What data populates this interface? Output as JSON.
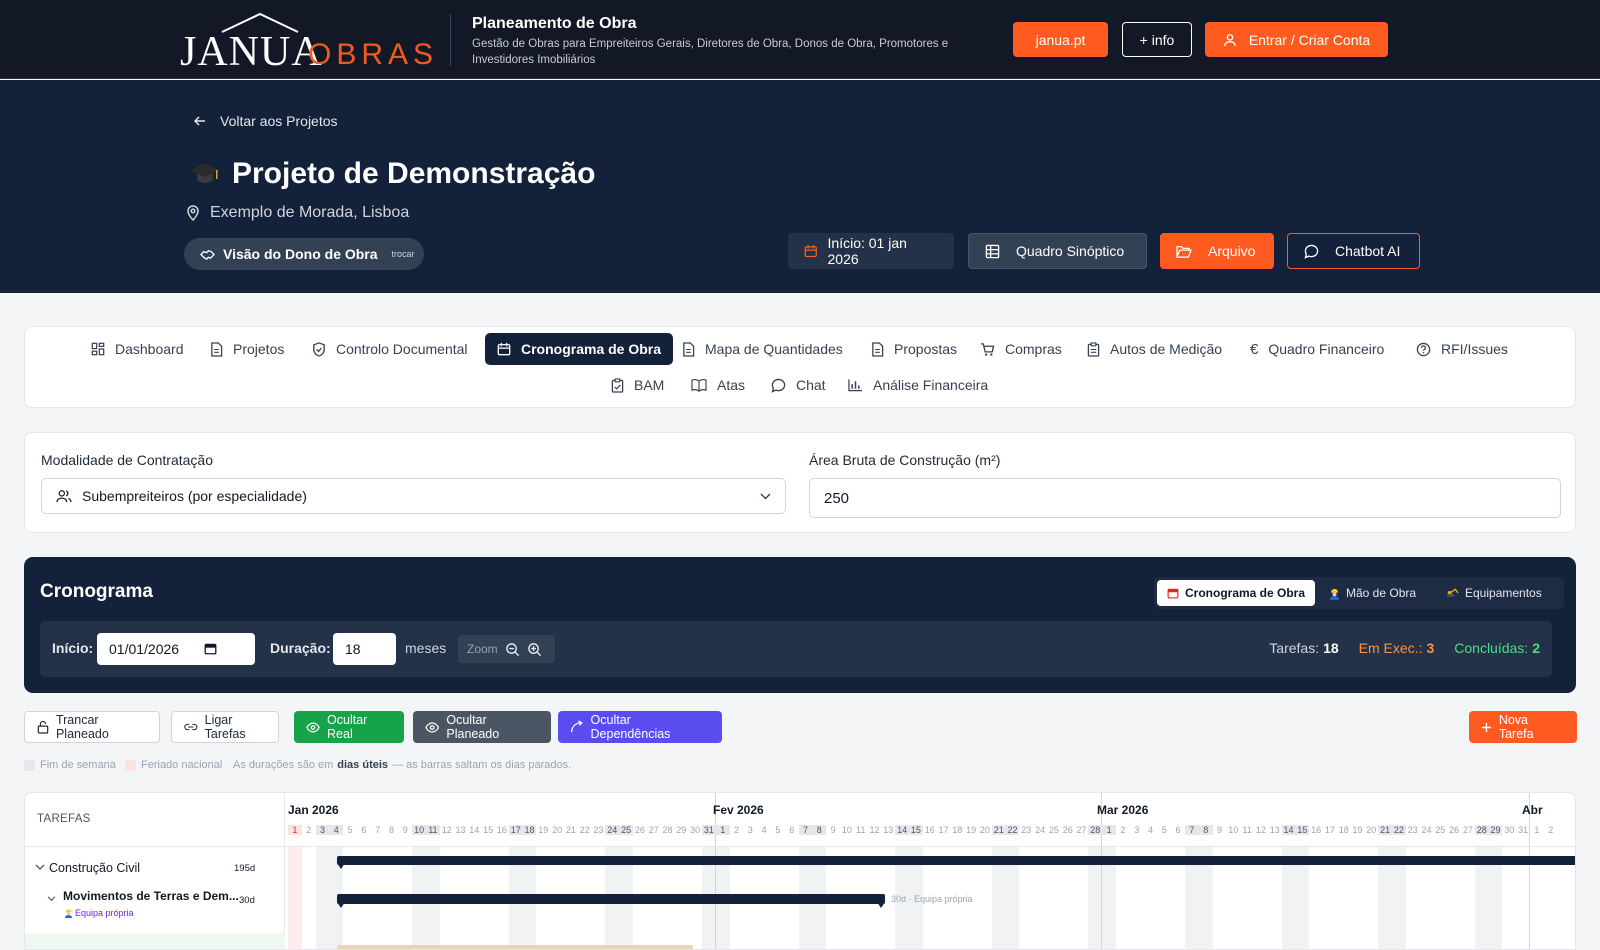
{
  "header": {
    "logo_main": "JANUA",
    "logo_sub": "OBRAS",
    "title": "Planeamento de Obra",
    "subtitle": "Gestão de Obras para Empreiteiros Gerais, Diretores de Obra, Donos de Obra, Promotores e Investidores Imobiliários",
    "btn_site": "janua.pt",
    "btn_info": "+ info",
    "btn_login": "Entrar / Criar Conta"
  },
  "hero": {
    "back_label": "Voltar aos Projetos",
    "project_title": "Projeto de Demonstração",
    "address": "Exemplo de Morada, Lisboa",
    "view_label": "Visão do Dono de Obra",
    "view_switch": "trocar",
    "start_label": "Início: 01 jan 2026",
    "btn_quadro": "Quadro Sinóptico",
    "btn_arquivo": "Arquivo",
    "btn_chatbot": "Chatbot AI"
  },
  "tabs": {
    "row1": [
      "Dashboard",
      "Projetos",
      "Controlo Documental",
      "Cronograma de Obra",
      "Mapa de Quantidades",
      "Propostas",
      "Compras",
      "Autos de Medição",
      "Quadro Financeiro",
      "RFI/Issues"
    ],
    "row2": [
      "BAM",
      "Atas",
      "Chat",
      "Análise Financeira"
    ],
    "active": "Cronograma de Obra"
  },
  "form": {
    "modalidade_label": "Modalidade de Contratação",
    "modalidade_value": "Subempreiteiros (por especialidade)",
    "area_label": "Área Bruta de Construção (m²)",
    "area_value": "250"
  },
  "cronograma": {
    "title": "Cronograma",
    "views": [
      "Cronograma de Obra",
      "Mão de Obra",
      "Equipamentos"
    ],
    "inicio_label": "Início:",
    "inicio_value": "01/01/2026",
    "duracao_label": "Duração:",
    "duracao_value": "18",
    "duracao_unit": "meses",
    "zoom_label": "Zoom",
    "stats": {
      "tarefas_label": "Tarefas:",
      "tarefas_value": "18",
      "exec_label": "Em Exec.:",
      "exec_value": "3",
      "concl_label": "Concluídas:",
      "concl_value": "2"
    }
  },
  "actions": {
    "trancar": "Trancar Planeado",
    "ligar": "Ligar Tarefas",
    "ocultar_real": "Ocultar Real",
    "ocultar_planeado": "Ocultar Planeado",
    "ocultar_dep": "Ocultar Dependências",
    "nova": "Nova Tarefa"
  },
  "legend": {
    "fim_semana": "Fim de semana",
    "feriado": "Feriado nacional",
    "note_pre": "As durações são em",
    "note_bold": "dias úteis",
    "note_post": "— as barras saltam os dias parados."
  },
  "gantt": {
    "tasks_header": "TAREFAS",
    "months": [
      "Jan 2026",
      "Fev 2026",
      "Mar 2026",
      "Abr"
    ],
    "rows": [
      {
        "name": "Construção Civil",
        "duration": "195d"
      },
      {
        "name": "Movimentos de Terras e Dem...",
        "team": "Equipa própria",
        "duration": "30d",
        "bar_label": "30d · Equipa própria"
      }
    ]
  },
  "colors": {
    "accent": "#ff5a1f",
    "navy": "#13213a",
    "green": "#16a34a",
    "purple": "#5b4cf0"
  }
}
